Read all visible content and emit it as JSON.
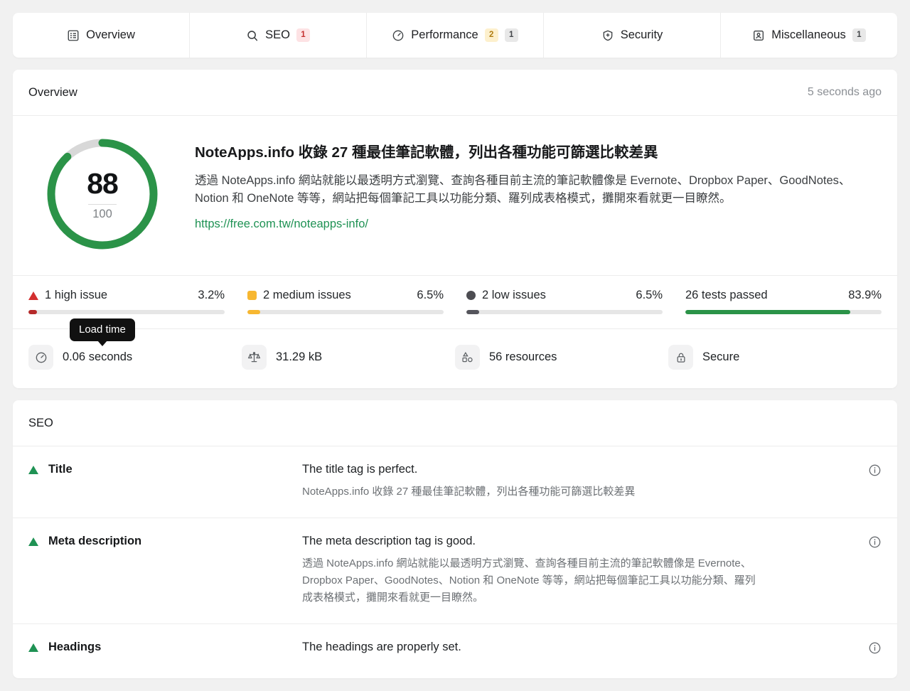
{
  "tabs": [
    {
      "label": "Overview",
      "icon": "list-report-icon",
      "badges": []
    },
    {
      "label": "SEO",
      "icon": "search-icon",
      "badges": [
        {
          "value": "1",
          "tone": "red"
        }
      ]
    },
    {
      "label": "Performance",
      "icon": "speedometer-icon",
      "badges": [
        {
          "value": "2",
          "tone": "yellow"
        },
        {
          "value": "1",
          "tone": "grey"
        }
      ]
    },
    {
      "label": "Security",
      "icon": "shield-icon",
      "badges": []
    },
    {
      "label": "Miscellaneous",
      "icon": "id-card-icon",
      "badges": [
        {
          "value": "1",
          "tone": "grey"
        }
      ]
    }
  ],
  "overview": {
    "card_title": "Overview",
    "timestamp": "5 seconds ago",
    "score": "88",
    "score_total": "100",
    "score_percent": 88,
    "gauge_color": "#2b9348",
    "gauge_track_color": "#d8d8d8",
    "site_title": "NoteApps.info 收錄 27 種最佳筆記軟體，列出各種功能可篩選比較差異",
    "site_description": "透過 NoteApps.info 網站就能以最透明方式瀏覽、查詢各種目前主流的筆記軟體像是 Evernote、Dropbox Paper、GoodNotes、Notion 和 OneNote 等等，網站把每個筆記工具以功能分類、羅列成表格模式，攤開來看就更一目瞭然。",
    "site_url": "https://free.com.tw/noteapps-info/",
    "issues": [
      {
        "marker": "triangle-red-icon",
        "label": "1 high issue",
        "percent_label": "3.2%",
        "percent": 3.2,
        "color": "#b52a2a"
      },
      {
        "marker": "square-yellow-icon",
        "label": "2 medium issues",
        "percent_label": "6.5%",
        "percent": 6.5,
        "color": "#f7b731"
      },
      {
        "marker": "circle-grey-icon",
        "label": "2 low issues",
        "percent_label": "6.5%",
        "percent": 6.5,
        "color": "#55555c"
      },
      {
        "marker": "none",
        "label": "26 tests passed",
        "percent_label": "83.9%",
        "percent": 83.9,
        "color": "#2b9348"
      }
    ],
    "metrics": [
      {
        "icon": "speedometer-icon",
        "value": "0.06 seconds",
        "tooltip": "Load time"
      },
      {
        "icon": "scale-icon",
        "value": "31.29 kB",
        "tooltip": ""
      },
      {
        "icon": "shapes-icon",
        "value": "56 resources",
        "tooltip": ""
      },
      {
        "icon": "lock-icon",
        "value": "Secure",
        "tooltip": ""
      }
    ]
  },
  "seo": {
    "card_title": "SEO",
    "rows": [
      {
        "status": "pass",
        "name": "Title",
        "headline": "The title tag is perfect.",
        "detail": "NoteApps.info 收錄 27 種最佳筆記軟體，列出各種功能可篩選比較差異",
        "info_icon": "info-icon"
      },
      {
        "status": "pass",
        "name": "Meta description",
        "headline": "The meta description tag is good.",
        "detail": "透過 NoteApps.info 網站就能以最透明方式瀏覽、查詢各種目前主流的筆記軟體像是 Evernote、Dropbox Paper、GoodNotes、Notion 和 OneNote 等等，網站把每個筆記工具以功能分類、羅列成表格模式，攤開來看就更一目瞭然。",
        "info_icon": "info-icon"
      },
      {
        "status": "pass",
        "name": "Headings",
        "headline": "The headings are properly set.",
        "detail": "",
        "info_icon": "info-icon"
      }
    ]
  }
}
